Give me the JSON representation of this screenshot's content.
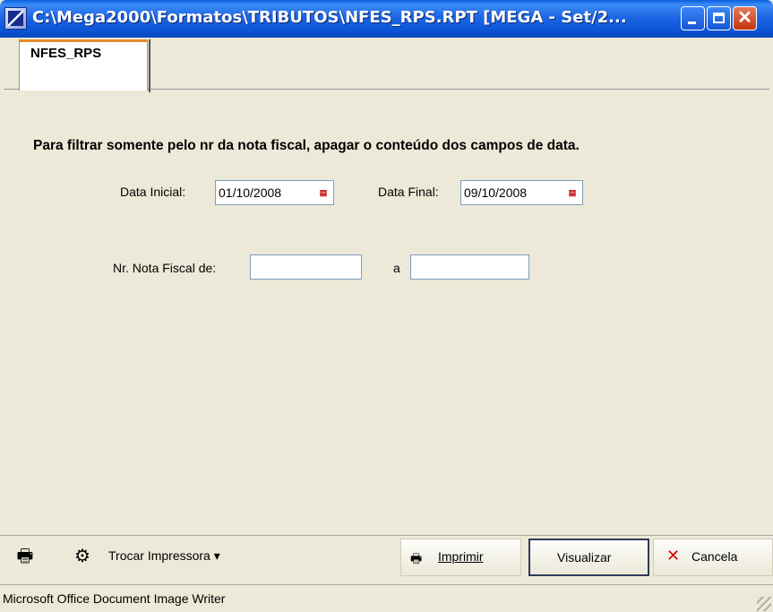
{
  "window": {
    "title": "C:\\Mega2000\\Formatos\\TRIBUTOS\\NFES_RPS.RPT [MEGA - Set/2...",
    "app_icon": "mega-icon"
  },
  "tabs": [
    {
      "label": "NFES_RPS",
      "selected": true
    }
  ],
  "form": {
    "instruction": "Para filtrar somente pelo nr da nota fiscal, apagar o conteúdo dos campos de data.",
    "data_inicial_label": "Data Inicial:",
    "data_inicial_value": "01/10/2008",
    "data_final_label": "Data Final:",
    "data_final_value": "09/10/2008",
    "nota_de_label": "Nr. Nota Fiscal de:",
    "nota_de_value": "",
    "nota_a_label": "a",
    "nota_a_value": ""
  },
  "toolbar": {
    "trocar_label": "Trocar Impressora",
    "imprimir_label": "Imprimir",
    "visualizar_label": "Visualizar",
    "cancela_label": "Cancela"
  },
  "status": {
    "text": "Microsoft Office Document Image Writer"
  }
}
